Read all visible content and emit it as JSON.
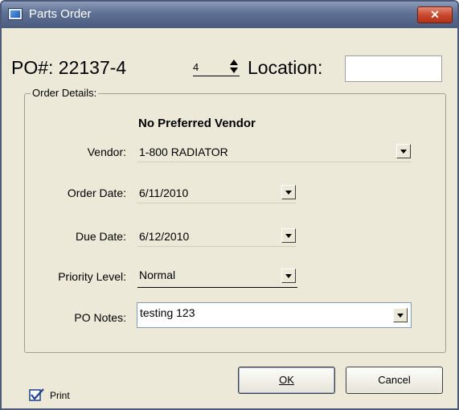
{
  "window": {
    "title": "Parts Order",
    "close_label": "✕"
  },
  "header": {
    "po_label": "PO#: 22137-4",
    "stepper_value": "4",
    "location_label": "Location:",
    "location_value": ""
  },
  "order_details": {
    "group_label": "Order Details:",
    "vendor_heading": "No Preferred Vendor",
    "vendor_label": "Vendor:",
    "vendor_value": "1-800 RADIATOR",
    "order_date_label": "Order Date:",
    "order_date_value": "6/11/2010",
    "due_date_label": "Due Date:",
    "due_date_value": "6/12/2010",
    "priority_label": "Priority Level:",
    "priority_value": "Normal",
    "notes_label": "PO Notes:",
    "notes_value": "testing 123"
  },
  "footer": {
    "print_label": "Print",
    "print_checked": true,
    "ok_label": "OK",
    "cancel_label": "Cancel"
  },
  "colors": {
    "titlebar": "#5d6f93",
    "close_button": "#c6452a",
    "dialog_background": "#ece9d8"
  }
}
